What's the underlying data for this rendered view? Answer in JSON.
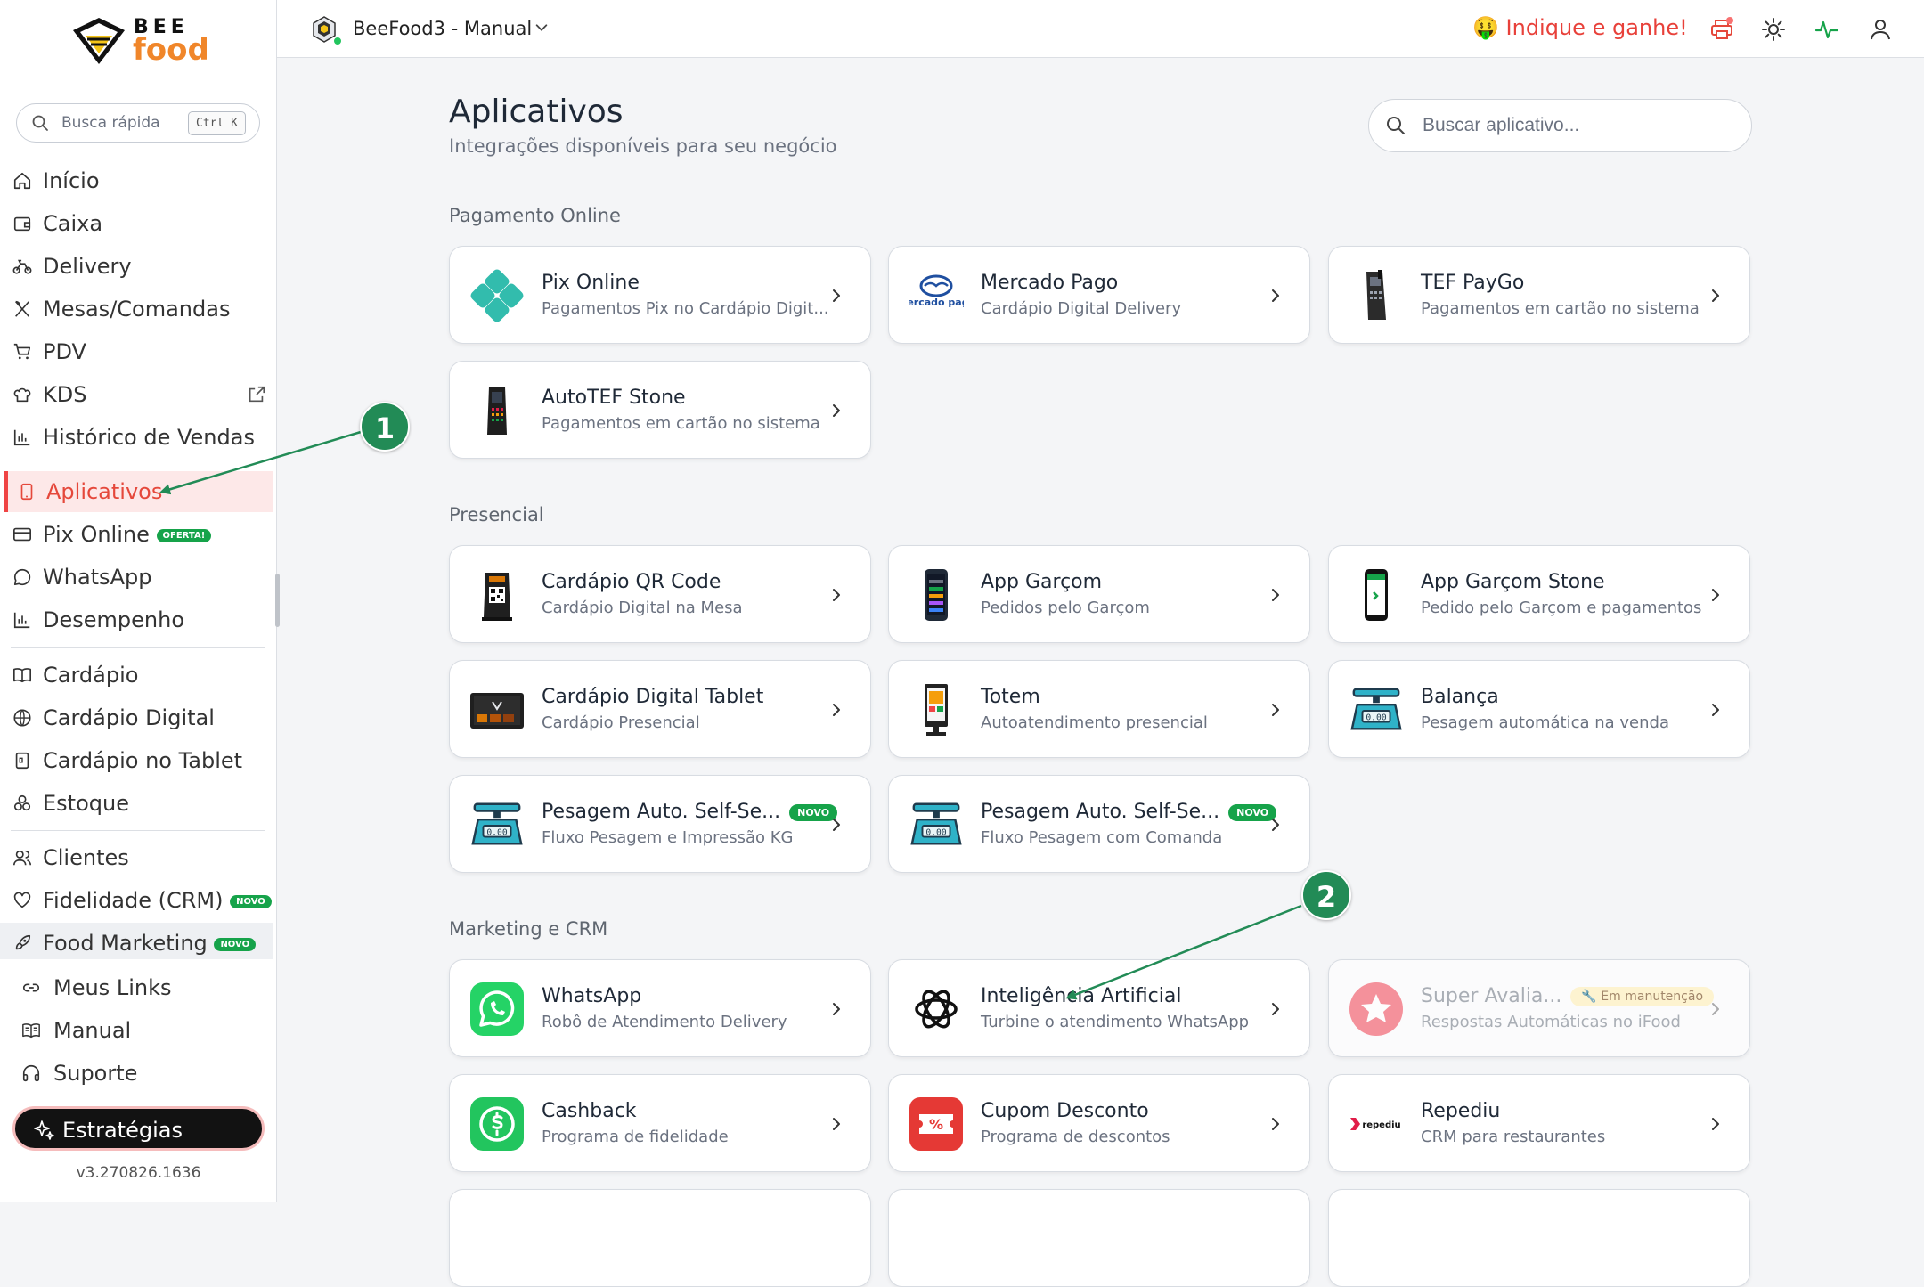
{
  "sidebar": {
    "logo": {
      "top": "BEE",
      "bottom": "food"
    },
    "quick_search": {
      "label": "Busca rápida",
      "shortcut": "Ctrl K"
    },
    "items": [
      {
        "label": "Início",
        "icon": "home-icon"
      },
      {
        "label": "Caixa",
        "icon": "wallet-icon"
      },
      {
        "label": "Delivery",
        "icon": "bike-icon"
      },
      {
        "label": "Mesas/Comandas",
        "icon": "utensils-icon"
      },
      {
        "label": "PDV",
        "icon": "cart-icon"
      },
      {
        "label": "KDS",
        "icon": "chef-hat-icon"
      },
      {
        "label": "Histórico de Vendas",
        "icon": "bar-chart-icon"
      },
      {
        "label": "Aplicativos",
        "icon": "tablet-icon"
      },
      {
        "label": "Pix Online",
        "icon": "card-icon",
        "badge": "OFERTA!"
      },
      {
        "label": "WhatsApp",
        "icon": "chat-icon"
      },
      {
        "label": "Desempenho",
        "icon": "bar-chart-icon"
      },
      {
        "label": "Cardápio",
        "icon": "book-icon"
      },
      {
        "label": "Cardápio Digital",
        "icon": "globe-icon"
      },
      {
        "label": "Cardápio no Tablet",
        "icon": "tablet-icon"
      },
      {
        "label": "Estoque",
        "icon": "boxes-icon"
      },
      {
        "label": "Clientes",
        "icon": "users-icon"
      },
      {
        "label": "Fidelidade (CRM)",
        "icon": "heart-icon",
        "badge": "NOVO"
      },
      {
        "label": "Food Marketing",
        "icon": "rocket-icon",
        "badge": "NOVO"
      },
      {
        "label": "Meus Links",
        "icon": "link-icon"
      },
      {
        "label": "Manual",
        "icon": "book-open-icon"
      },
      {
        "label": "Suporte",
        "icon": "headset-icon"
      }
    ],
    "strategies": "Estratégias",
    "version": "v3.270826.1636"
  },
  "topbar": {
    "workspace": "BeeFood3 - Manual",
    "referral": "Indique e ganhe!",
    "referral_emoji": "🤑"
  },
  "main": {
    "title": "Aplicativos",
    "subtitle": "Integrações disponíveis para seu negócio",
    "search_placeholder": "Buscar aplicativo...",
    "sections": [
      {
        "title": "Pagamento Online",
        "apps": [
          {
            "title": "Pix Online",
            "subtitle": "Pagamentos Pix no Cardápio Digit..."
          },
          {
            "title": "Mercado Pago",
            "subtitle": "Cardápio Digital Delivery",
            "logo_text": "mercado pago"
          },
          {
            "title": "TEF PayGo",
            "subtitle": "Pagamentos em cartão no sistema"
          },
          {
            "title": "AutoTEF Stone",
            "subtitle": "Pagamentos em cartão no sistema"
          }
        ]
      },
      {
        "title": "Presencial",
        "apps": [
          {
            "title": "Cardápio QR Code",
            "subtitle": "Cardápio Digital na Mesa"
          },
          {
            "title": "App Garçom",
            "subtitle": "Pedidos pelo Garçom"
          },
          {
            "title": "App Garçom Stone",
            "subtitle": "Pedido pelo Garçom e pagamentos"
          },
          {
            "title": "Cardápio Digital Tablet",
            "subtitle": "Cardápio Presencial"
          },
          {
            "title": "Totem",
            "subtitle": "Autoatendimento presencial"
          },
          {
            "title": "Balança",
            "subtitle": "Pesagem automática na venda"
          },
          {
            "title": "Pesagem Auto. Self-Se...",
            "subtitle": "Fluxo Pesagem e Impressão KG",
            "badge": "NOVO"
          },
          {
            "title": "Pesagem Auto. Self-Se...",
            "subtitle": "Fluxo Pesagem com Comanda",
            "badge": "NOVO"
          }
        ]
      },
      {
        "title": "Marketing e CRM",
        "apps": [
          {
            "title": "WhatsApp",
            "subtitle": "Robô de Atendimento Delivery"
          },
          {
            "title": "Inteligência Artificial",
            "subtitle": "Turbine o atendimento WhatsApp"
          },
          {
            "title": "Super Avalia...",
            "subtitle": "Respostas Automáticas no iFood",
            "badge": "Em manutenção"
          },
          {
            "title": "Cashback",
            "subtitle": "Programa de fidelidade"
          },
          {
            "title": "Cupom Desconto",
            "subtitle": "Programa de descontos"
          },
          {
            "title": "Repediu",
            "subtitle": "CRM para restaurantes",
            "logo_text": "repediu"
          }
        ]
      }
    ]
  },
  "annotations": [
    {
      "label": "1"
    },
    {
      "label": "2"
    }
  ],
  "colors": {
    "accent_red": "#e5483b",
    "badge_green": "#16a34a",
    "annotation_green": "#228b56"
  }
}
